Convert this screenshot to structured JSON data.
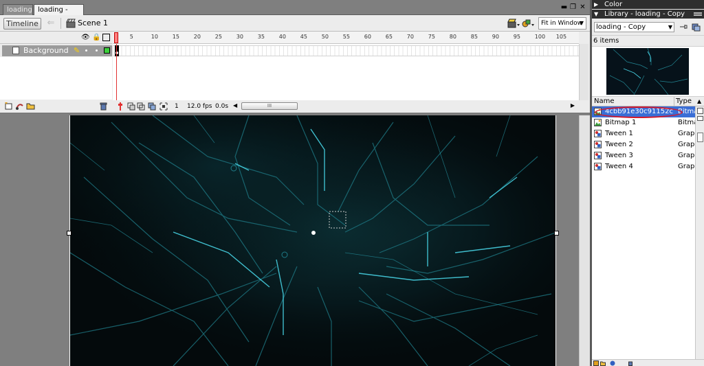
{
  "document_tabs": [
    {
      "label": "loading"
    },
    {
      "label": "loading - Copy*"
    }
  ],
  "window_controls": {
    "minimize": "▬",
    "restore": "❐",
    "close": "✕"
  },
  "edit_bar": {
    "timeline_button": "Timeline",
    "scene_label": "Scene 1",
    "zoom_value": "Fit in Window"
  },
  "timeline": {
    "layer_name": "Background",
    "frame_ruler": [
      "5",
      "10",
      "15",
      "20",
      "25",
      "30",
      "35",
      "40",
      "45",
      "50",
      "55",
      "60",
      "65",
      "70",
      "75",
      "80",
      "85",
      "90",
      "95",
      "100",
      "105"
    ],
    "current_frame": "1",
    "frame_rate": "12.0 fps",
    "elapsed_time": "0.0s",
    "scroll_thumb_grip": "III"
  },
  "panels": {
    "color_header": "Color",
    "library_header": "Library - loading - Copy",
    "library_document": "loading - Copy",
    "item_count": "6 items",
    "columns": {
      "name": "Name",
      "type": "Type"
    },
    "items": [
      {
        "name": "4cbb91e30c91152c...",
        "type": "Bitmap",
        "icon": "bitmap-icon",
        "selected": true
      },
      {
        "name": "Bitmap 1",
        "type": "Bitmap",
        "icon": "bitmap-icon",
        "selected": false
      },
      {
        "name": "Tween 1",
        "type": "Graphic",
        "icon": "graphic-symbol-icon",
        "selected": false
      },
      {
        "name": "Tween 2",
        "type": "Graphic",
        "icon": "graphic-symbol-icon",
        "selected": false
      },
      {
        "name": "Tween 3",
        "type": "Graphic",
        "icon": "graphic-symbol-icon",
        "selected": false
      },
      {
        "name": "Tween 4",
        "type": "Graphic",
        "icon": "graphic-symbol-icon",
        "selected": false
      }
    ]
  },
  "colors": {
    "stage_background": "#040a0c",
    "circuit_line": "#3fc9d9",
    "selection_highlight": "#3a6ed6",
    "annotation_ring": "#d21a2c",
    "layer_outline": "#3ccf3c",
    "playhead": "#e23030"
  }
}
